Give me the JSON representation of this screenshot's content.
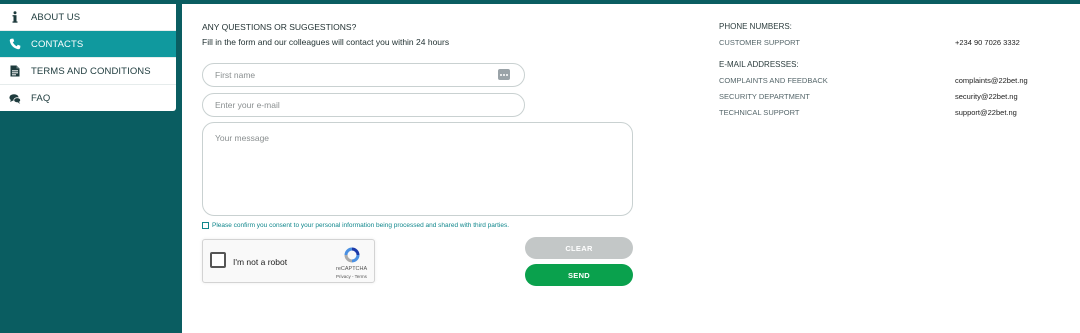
{
  "sidebar": {
    "items": [
      {
        "label": "ABOUT US",
        "icon": "info-icon",
        "active": false
      },
      {
        "label": "CONTACTS",
        "icon": "phone-icon",
        "active": true
      },
      {
        "label": "TERMS AND CONDITIONS",
        "icon": "document-icon",
        "active": false
      },
      {
        "label": "FAQ",
        "icon": "chat-bubbles-icon",
        "active": false
      }
    ]
  },
  "form": {
    "heading": "ANY QUESTIONS OR SUGGESTIONS?",
    "subheading": "Fill in the form and our colleagues will contact you within 24 hours",
    "first_name_placeholder": "First name",
    "email_placeholder": "Enter your e-mail",
    "message_placeholder": "Your message",
    "consent_text": "Please confirm you consent to your personal information being processed and shared with third parties.",
    "clear_label": "CLEAR",
    "send_label": "SEND"
  },
  "captcha": {
    "label": "I'm not a robot",
    "brand": "reCAPTCHA",
    "links": "Privacy - Terms"
  },
  "contacts": {
    "phone_heading": "PHONE NUMBERS:",
    "phones": [
      {
        "label": "CUSTOMER SUPPORT",
        "value": "+234 90 7026 3332"
      }
    ],
    "email_heading": "E-MAIL ADDRESSES:",
    "emails": [
      {
        "label": "COMPLAINTS AND FEEDBACK",
        "value": "complaints@22bet.ng"
      },
      {
        "label": "SECURITY DEPARTMENT",
        "value": "security@22bet.ng"
      },
      {
        "label": "TECHNICAL SUPPORT",
        "value": "support@22bet.ng"
      }
    ]
  },
  "colors": {
    "background": "#0a5d61",
    "active_item": "#10999e",
    "send_button": "#0aa14d",
    "clear_button": "#c3c7c7"
  }
}
